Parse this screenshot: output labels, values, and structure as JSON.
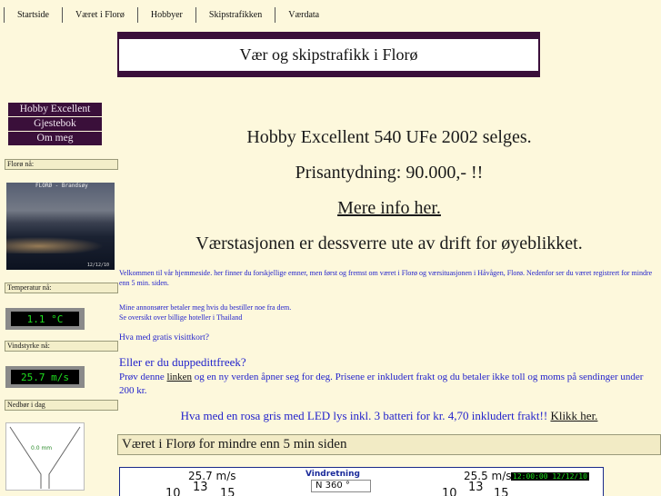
{
  "nav": {
    "items": [
      "Startside",
      "Været i Florø",
      "Hobbyer",
      "Skipstrafikken",
      "Værdata"
    ]
  },
  "banner": {
    "title": "Vær og skipstrafikk i Florø"
  },
  "sidemenu": {
    "items": [
      "Hobby Excellent",
      "Gjestebok",
      "Om meg"
    ]
  },
  "left": {
    "floro_label": "Florø nå:",
    "webcam_title": "FLORØ - Brandsøy",
    "webcam_time": "12/12/10",
    "temp_label": "Temperatur nå:",
    "temp_value": "1.1 °C",
    "wind_label": "Vindstyrke nå:",
    "wind_value": "25.7 m/s",
    "rain_label": "Nedbør i dag",
    "rain_value": "0.0 mm"
  },
  "main": {
    "line1": "Hobby Excellent 540 UFe 2002 selges.",
    "line2": "Prisantydning: 90.000,- !!",
    "line3_link": "Mere info her.",
    "line4": "Værstasjonen er dessverre ute av drift for øyeblikket.",
    "welcome": "Velkommen til vår hjemmeside. her finner du forskjellige emner, men først og fremst om været i Florø og værsituasjonen i Håvågen, Florø. Nedenfor ser du været registrert for mindre enn 5 min. siden.",
    "sponsor1": "Mine annonsører betaler meg hvis du bestiller noe fra dem.",
    "sponsor2": "Se oversikt over billige hoteller i Thailand",
    "visit": "Hva med gratis visittkort?",
    "dupp_title": "Eller er du duppedittfreek?",
    "dupp_pre": "Prøv denne ",
    "dupp_link": "linken",
    "dupp_post": " og en ny verden åpner seg for deg. Prisene er inkludert frakt og du betaler ikke toll og moms på sendinger under 200 kr.",
    "led_pre": "Hva med en rosa gris med LED lys  inkl. 3 batteri for kr. 4,70 inkludert frakt!! ",
    "led_link": "Klikk her.",
    "section": "Været i Florø for mindre enn 5 min siden"
  },
  "weather_panel": {
    "wind_left": "25.7 m/s",
    "gauge_left": [
      "10",
      "13",
      "15"
    ],
    "dir_label": "Vindretning",
    "dir_value": "N  360 °",
    "wind_right": "25.5 m/s",
    "gauge_right": [
      "10",
      "13",
      "15"
    ],
    "clock": "12:00:00 12/12/10"
  },
  "colors": {
    "page_bg": "#fdf8dc",
    "menu_bg": "#3a0f3a",
    "blue_text": "#2222cc",
    "lcd_green": "#1fe01f"
  }
}
